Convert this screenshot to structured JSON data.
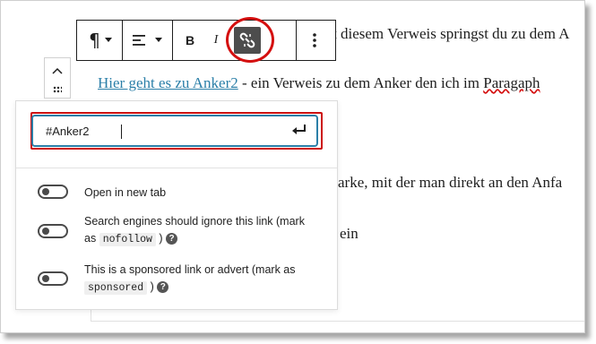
{
  "editor": {
    "line1_tail": "t diesem Verweis springst du zu dem A",
    "line2_link": "Hier geht es zu Anker2",
    "line2_rest": " - ein Verweis zu dem Anker den ich im ",
    "line2_underlined": "Paragaph",
    "line3_tail": "arke, mit der man direkt an den Anfa",
    "line4_tail": "ein"
  },
  "toolbar": {
    "paragraph_icon": "pilcrow-icon",
    "align_icon": "align-left-icon",
    "bold_label": "B",
    "italic_label": "I",
    "unlink_icon": "link-off-icon",
    "more_icon": "vertical-dots-icon"
  },
  "link_popover": {
    "url_value": "#Anker2",
    "submit_icon": "enter-icon",
    "options": [
      {
        "label": "Open in new tab",
        "enabled": false
      },
      {
        "label_pre": "Search engines should ignore this link (mark as",
        "code": "nofollow",
        "label_post": ")",
        "enabled": false
      },
      {
        "label_pre": "This is a sponsored link or advert (mark as",
        "code": "sponsored",
        "label_post": ")",
        "enabled": false
      }
    ],
    "help_glyph": "?"
  },
  "colors": {
    "highlight_red": "#d40f0f",
    "link_color": "#2b7fa8",
    "active_button": "#4d4d4d"
  }
}
